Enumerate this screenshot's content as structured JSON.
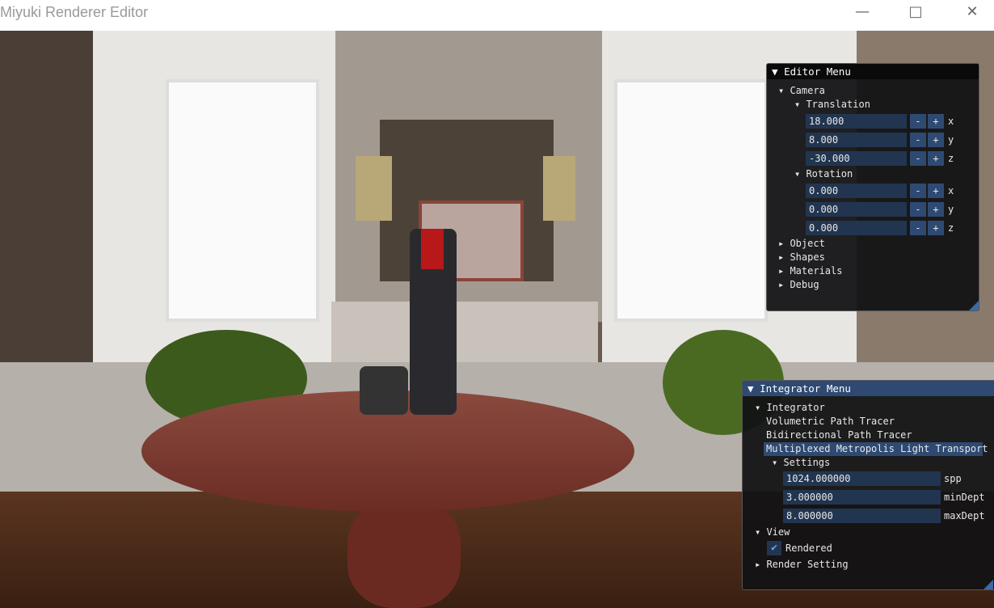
{
  "window": {
    "title": "Miyuki Renderer Editor",
    "minimize_icon": "minimize-icon",
    "maximize_icon": "maximize-icon",
    "close_icon": "close-icon"
  },
  "editor_menu": {
    "title": "Editor Menu",
    "camera": {
      "label": "Camera",
      "translation": {
        "label": "Translation",
        "fields": [
          {
            "value": "18.000",
            "axis": "x"
          },
          {
            "value": "8.000",
            "axis": "y"
          },
          {
            "value": "-30.000",
            "axis": "z"
          }
        ]
      },
      "rotation": {
        "label": "Rotation",
        "fields": [
          {
            "value": "0.000",
            "axis": "x"
          },
          {
            "value": "0.000",
            "axis": "y"
          },
          {
            "value": "0.000",
            "axis": "z"
          }
        ]
      }
    },
    "minus": "-",
    "plus": "+",
    "sections": [
      "Object",
      "Shapes",
      "Materials",
      "Debug"
    ]
  },
  "integrator_menu": {
    "title": "Integrator Menu",
    "integrator_label": "Integrator",
    "options": [
      "Volumetric Path Tracer",
      "Bidirectional Path Tracer",
      "Multiplexed Metropolis Light Transport"
    ],
    "selected_index": 2,
    "settings_label": "Settings",
    "settings": [
      {
        "value": "1024.000000",
        "label": "spp"
      },
      {
        "value": "3.000000",
        "label": "minDept"
      },
      {
        "value": "8.000000",
        "label": "maxDept"
      }
    ],
    "view_label": "View",
    "rendered_label": "Rendered",
    "rendered_checked": true,
    "render_setting_label": "Render Setting"
  },
  "colors": {
    "input_bg": "#223550",
    "button_bg": "#2e4a72",
    "selected_bg": "#2e4a72",
    "integrator_title_bg": "#2e4a72"
  }
}
